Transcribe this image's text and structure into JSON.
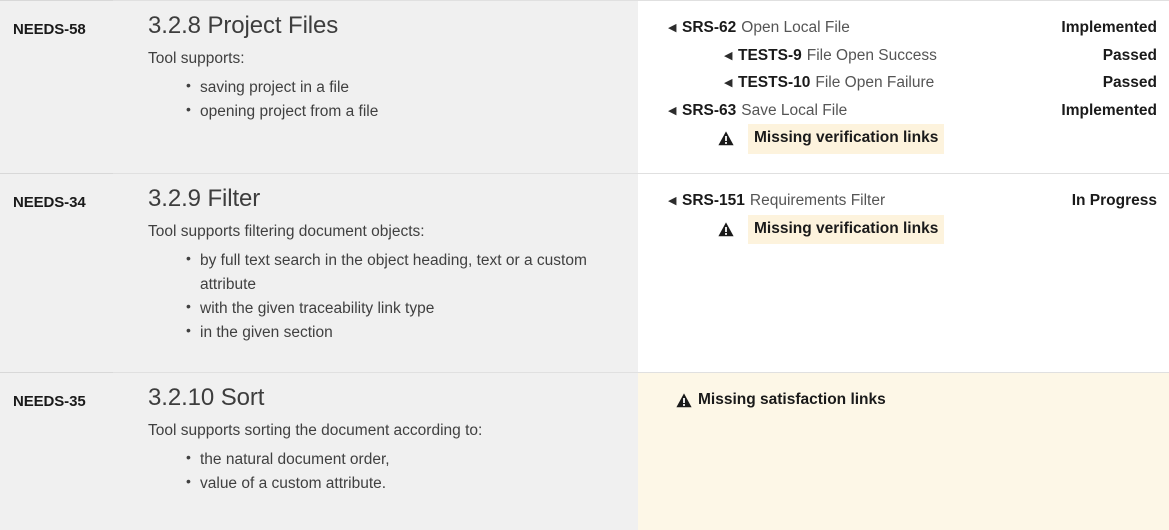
{
  "view": {
    "name": "requirements-traceability-matrix",
    "colors": {
      "left_pane_bg": "#f0f0f0",
      "right_pane_bg": "#ffffff",
      "warning_row_bg": "#fdf7e7",
      "warning_highlight_bg": "#fdf3dd",
      "row_divider": "#e0e0e0",
      "key_text": "#1a1a1a",
      "body_text": "#404040",
      "trace_title_text": "#555555"
    },
    "icons": {
      "link_arrow": "◀",
      "warning": "warning-triangle-icon"
    }
  },
  "rows": [
    {
      "key": "NEEDS-58",
      "title": "3.2.8 Project Files",
      "intro": "Tool supports:",
      "bullets": [
        "saving project in a file",
        "opening project from a file"
      ],
      "right_warning_background": false,
      "trace": [
        {
          "kind": "link",
          "level": 1,
          "key": "SRS-62",
          "title": "Open Local File",
          "status": "Implemented"
        },
        {
          "kind": "link",
          "level": 2,
          "key": "TESTS-9",
          "title": "File Open Success",
          "status": "Passed"
        },
        {
          "kind": "link",
          "level": 2,
          "key": "TESTS-10",
          "title": "File Open Failure",
          "status": "Passed"
        },
        {
          "kind": "link",
          "level": 1,
          "key": "SRS-63",
          "title": "Save Local File",
          "status": "Implemented"
        },
        {
          "kind": "warning",
          "level": 2,
          "highlighted": true,
          "text": "Missing verification links"
        }
      ]
    },
    {
      "key": "NEEDS-34",
      "title": "3.2.9 Filter",
      "intro": "Tool supports filtering document objects:",
      "bullets": [
        "by full text search in the object heading, text or a custom attribute",
        "with the given traceability link type",
        "in the given section"
      ],
      "right_warning_background": false,
      "trace": [
        {
          "kind": "link",
          "level": 1,
          "key": "SRS-151",
          "title": "Requirements Filter",
          "status": "In Progress"
        },
        {
          "kind": "warning",
          "level": 2,
          "highlighted": true,
          "text": "Missing verification links"
        }
      ]
    },
    {
      "key": "NEEDS-35",
      "title": "3.2.10 Sort",
      "intro": "Tool supports sorting the document according to:",
      "bullets": [
        "the natural document order,",
        "value of a custom attribute."
      ],
      "right_warning_background": true,
      "trace": [
        {
          "kind": "warning",
          "level": 1,
          "highlighted": false,
          "text": "Missing satisfaction links"
        }
      ]
    }
  ]
}
